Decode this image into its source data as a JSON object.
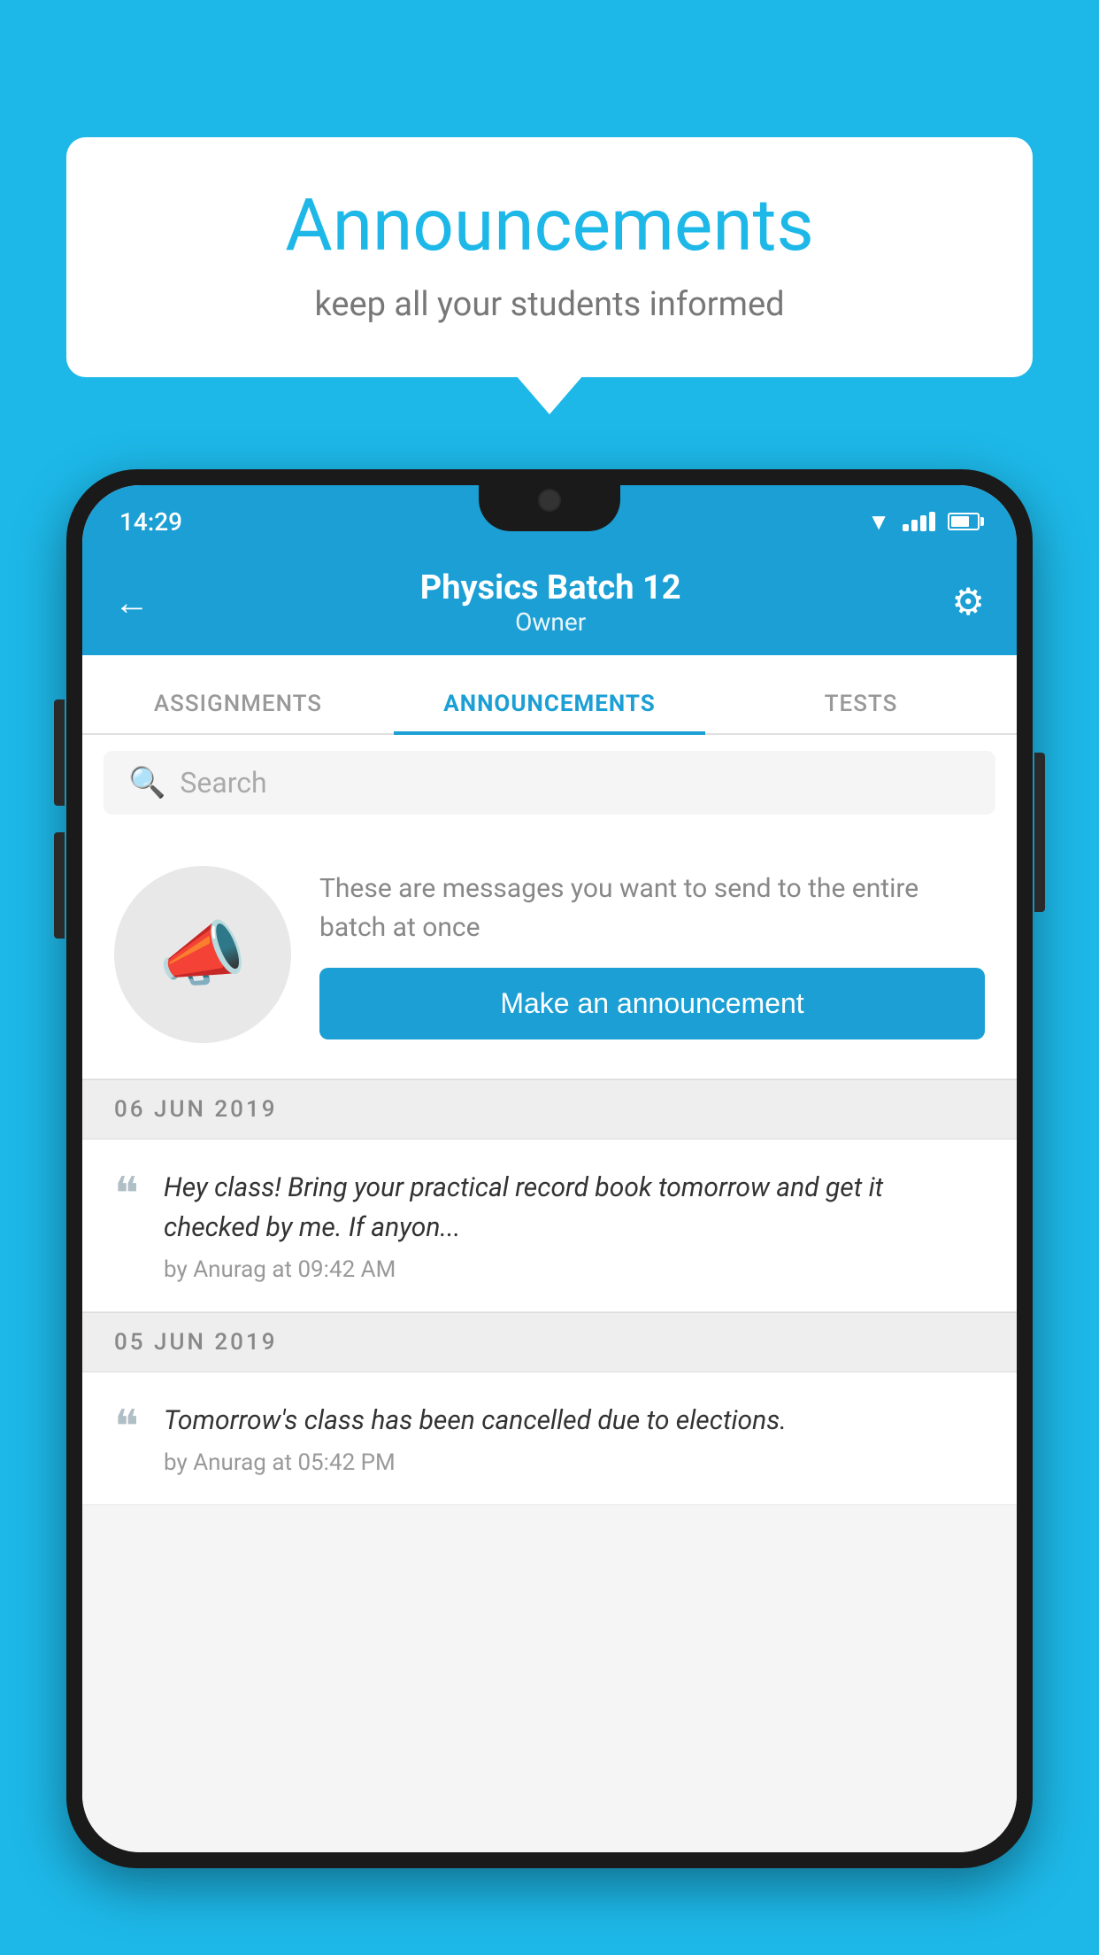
{
  "background_color": "#1db8e8",
  "speech_bubble": {
    "title": "Announcements",
    "subtitle": "keep all your students informed"
  },
  "phone": {
    "status_bar": {
      "time": "14:29"
    },
    "app_bar": {
      "title": "Physics Batch 12",
      "subtitle": "Owner",
      "back_label": "←",
      "settings_label": "⚙"
    },
    "tabs": [
      {
        "label": "ASSIGNMENTS",
        "active": false
      },
      {
        "label": "ANNOUNCEMENTS",
        "active": true
      },
      {
        "label": "TESTS",
        "active": false
      }
    ],
    "search": {
      "placeholder": "Search"
    },
    "promo": {
      "text": "These are messages you want to send to the entire batch at once",
      "button_label": "Make an announcement"
    },
    "announcements": [
      {
        "date": "06  JUN  2019",
        "text": "Hey class! Bring your practical record book tomorrow and get it checked by me. If anyon...",
        "meta": "by Anurag at 09:42 AM"
      },
      {
        "date": "05  JUN  2019",
        "text": "Tomorrow's class has been cancelled due to elections.",
        "meta": "by Anurag at 05:42 PM"
      }
    ]
  }
}
